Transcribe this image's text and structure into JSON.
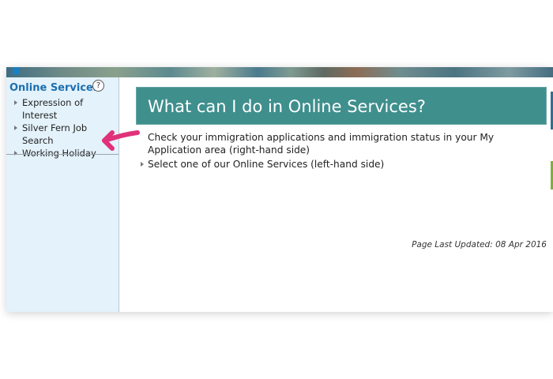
{
  "sidebar": {
    "title": "Online Services",
    "help": "?",
    "items": [
      {
        "label": "Expression of Interest"
      },
      {
        "label": "Silver Fern Job Search"
      },
      {
        "label": "Working Holiday"
      }
    ]
  },
  "main": {
    "heading": "What can I do in Online Services?",
    "bullets": [
      {
        "text": "Check your immigration applications and immigration status in your My Application area (right-hand side)"
      },
      {
        "text": "Select one of our Online Services (left-hand side)"
      }
    ],
    "updated": "Page Last Updated: 08 Apr 2016"
  },
  "colors": {
    "heading_bg": "#3f8f8d",
    "sidebar_bg": "#e4f2fb",
    "sidebar_title": "#1c6fb0",
    "arrow": "#e0327a"
  }
}
